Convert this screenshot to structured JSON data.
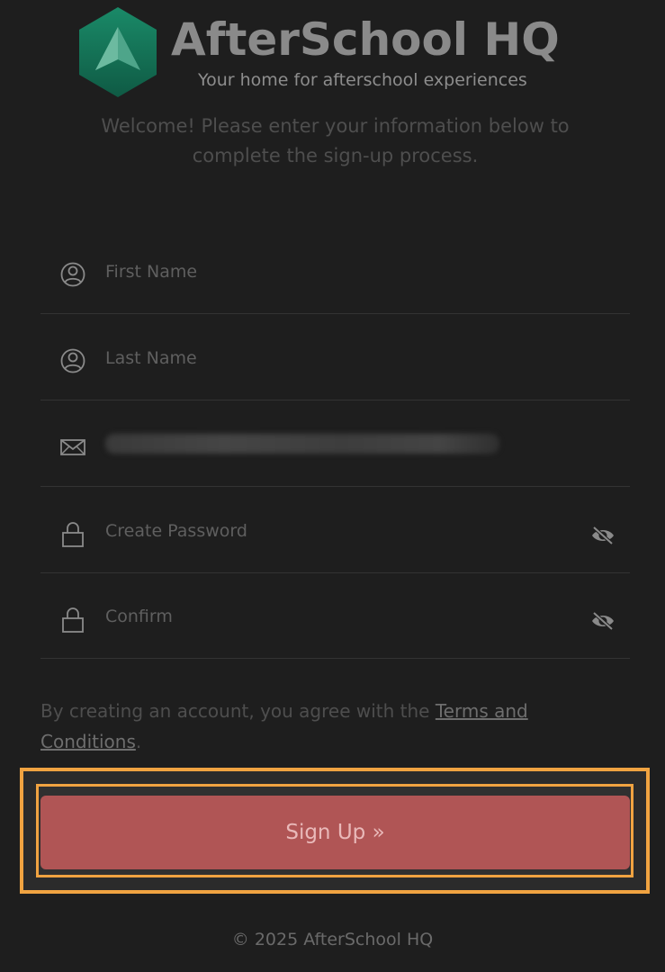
{
  "brand": {
    "name": "AfterSchool HQ",
    "tagline": "Your home for afterschool experiences"
  },
  "welcome_text": "Welcome! Please enter your information below to complete the sign-up process.",
  "form": {
    "first_name": {
      "placeholder": "First Name",
      "icon": "user-circle-icon"
    },
    "last_name": {
      "placeholder": "Last Name",
      "icon": "user-circle-icon"
    },
    "email": {
      "icon": "envelope-icon"
    },
    "password": {
      "placeholder": "Create Password",
      "icon": "lock-icon",
      "toggle_icon": "eye-slash-icon"
    },
    "confirm": {
      "placeholder": "Confirm",
      "icon": "lock-icon",
      "toggle_icon": "eye-slash-icon"
    }
  },
  "terms": {
    "prefix": "By creating an account, you agree with the ",
    "link_part1": "Terms and",
    "link_part2": "Conditions",
    "suffix": "."
  },
  "signup_button_label": "Sign Up »",
  "footer": "© 2025 AfterSchool HQ",
  "colors": {
    "background": "#1e1e1e",
    "button": "#b05555",
    "highlight": "#f0a341",
    "logo_green": "#1f7a5a"
  }
}
